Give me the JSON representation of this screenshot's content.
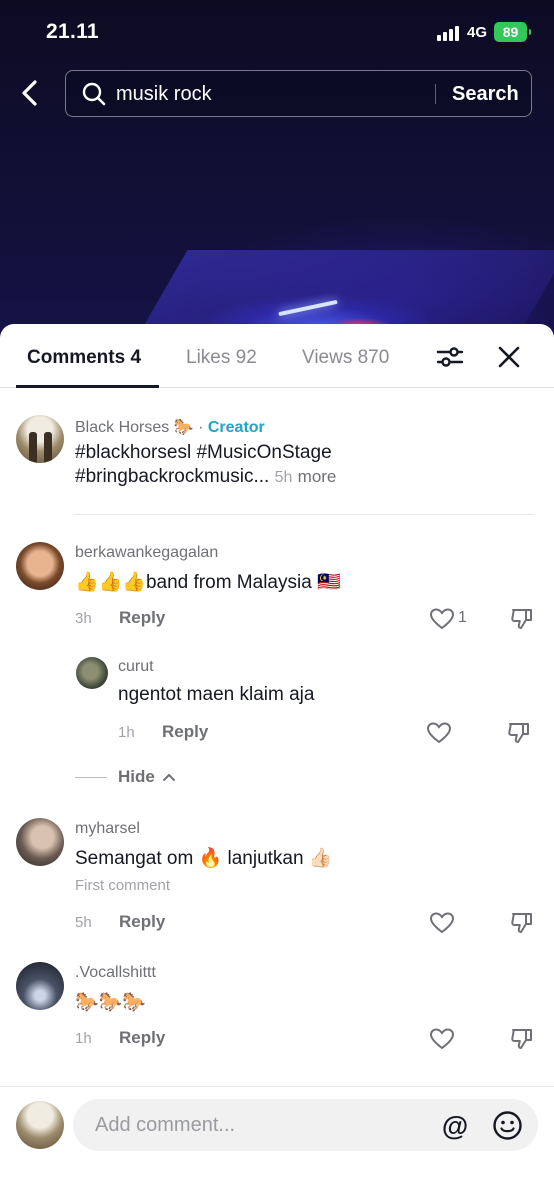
{
  "status_bar": {
    "time": "21.11",
    "network": "4G",
    "battery": "89"
  },
  "search": {
    "query": "musik rock",
    "button_label": "Search"
  },
  "tabs": {
    "comments": "Comments 4",
    "likes": "Likes 92",
    "views": "Views 870"
  },
  "creator_post": {
    "username": "Black Horses 🐎",
    "separator": "·",
    "creator_label": "Creator",
    "line1": "#blackhorsesl #MusicOnStage",
    "line2": "#bringbackrockmusic...",
    "time": "5h",
    "more_label": "more"
  },
  "comments": [
    {
      "username": "berkawankegagalan",
      "text": "👍👍👍band from Malaysia 🇲🇾",
      "time": "3h",
      "reply_label": "Reply",
      "likes": "1"
    },
    {
      "username": "curut",
      "text": "ngentot maen klaim aja",
      "time": "1h",
      "reply_label": "Reply"
    },
    {
      "username": "myharsel",
      "text": "Semangat om 🔥 lanjutkan 👍🏻",
      "note": "First comment",
      "time": "5h",
      "reply_label": "Reply"
    },
    {
      "username": ".Vocallshittt",
      "text": "🐎🐎🐎",
      "time": "1h",
      "reply_label": "Reply"
    }
  ],
  "hide_label": "Hide",
  "composer": {
    "placeholder": "Add comment...",
    "mention_symbol": "@"
  },
  "icons": [
    "back-icon",
    "search-icon",
    "filter-icon",
    "close-icon",
    "heart-icon",
    "dislike-icon",
    "chevron-up-icon",
    "emoji-icon"
  ],
  "colors": {
    "creator_accent": "#20a4c9",
    "battery": "#34c759"
  }
}
